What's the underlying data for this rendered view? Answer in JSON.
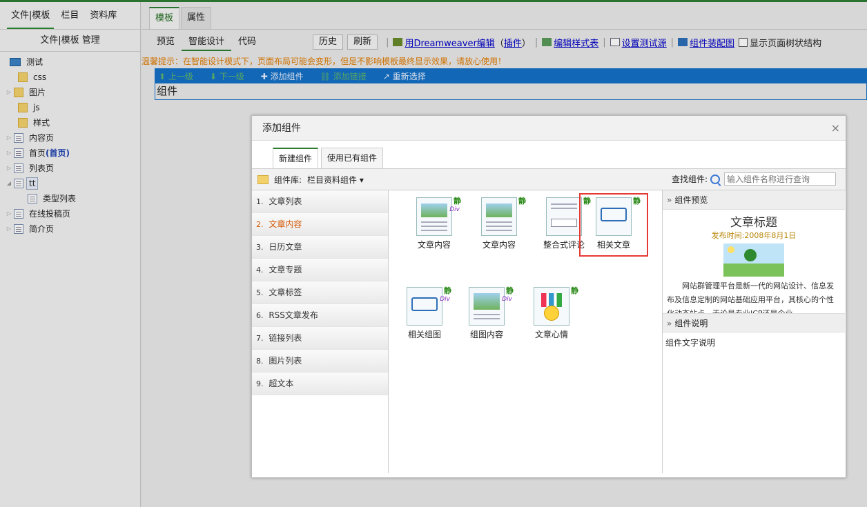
{
  "left": {
    "tabs": [
      "文件|模板",
      "栏目",
      "资料库"
    ],
    "title": "文件|模板 管理",
    "tree": [
      {
        "label": "测试",
        "icon": "monitor-icon"
      },
      {
        "label": "css",
        "icon": "folder-icon"
      },
      {
        "label": "图片",
        "icon": "folder-icon"
      },
      {
        "label": "js",
        "icon": "folder-icon"
      },
      {
        "label": "样式",
        "icon": "style-folder-icon"
      },
      {
        "label": "内容页",
        "icon": "page-icon"
      },
      {
        "label": "首页",
        "extra": "(首页)",
        "icon": "home-page-icon"
      },
      {
        "label": "列表页",
        "icon": "page-icon"
      },
      {
        "label": "tt",
        "icon": "page-icon"
      },
      {
        "label": "类型列表",
        "icon": "page-icon"
      },
      {
        "label": "在线投稿页",
        "icon": "edit-page-icon"
      },
      {
        "label": "简介页",
        "icon": "edit-page-icon"
      }
    ]
  },
  "main": {
    "tabs": [
      "模板",
      "属性"
    ],
    "view_tabs": [
      "预览",
      "智能设计",
      "代码"
    ],
    "buttons": [
      "历史",
      "刷新"
    ],
    "links": {
      "dreamweaver": "用Dreamweaver编辑",
      "paren_open": "（",
      "plugin": "插件",
      "paren_close": "）",
      "edit_style": "编辑样式表",
      "test_source": "设置测试源",
      "assembly": "组件装配图",
      "show_tree": "显示页面树状结构"
    },
    "warning": "温馨提示：在智能设计模式下，页面布局可能会变形，但是不影响模板最终显示效果，请放心使用！",
    "bluebar": [
      "上一级",
      "下一级",
      "添加组件",
      "添加链接",
      "重新选择"
    ],
    "component_label": "组件"
  },
  "dialog": {
    "title": "添加组件",
    "close": "×",
    "tabs": [
      "新建组件",
      "使用已有组件"
    ],
    "library_label": "组件库:",
    "library_value": "栏目资料组件",
    "search_label": "查找组件:",
    "search_placeholder": "输入组件名称进行查询",
    "categories": [
      {
        "num": "1.",
        "label": "文章列表"
      },
      {
        "num": "2.",
        "label": "文章内容"
      },
      {
        "num": "3.",
        "label": "日历文章"
      },
      {
        "num": "4.",
        "label": "文章专题"
      },
      {
        "num": "5.",
        "label": "文章标签"
      },
      {
        "num": "6.",
        "label": "RSS文章发布"
      },
      {
        "num": "7.",
        "label": "链接列表"
      },
      {
        "num": "8.",
        "label": "图片列表"
      },
      {
        "num": "9.",
        "label": "超文本"
      }
    ],
    "items": [
      {
        "label": "文章内容",
        "badge": "静",
        "div": "Div"
      },
      {
        "label": "文章内容",
        "badge": "静",
        "div": ""
      },
      {
        "label": "整合式评论",
        "badge": "静",
        "div": ""
      },
      {
        "label": "相关文章",
        "badge": "静",
        "div": ""
      },
      {
        "label": "相关组图",
        "badge": "静",
        "div": "Div"
      },
      {
        "label": "组图内容",
        "badge": "静",
        "div": "Div"
      },
      {
        "label": "文章心情",
        "badge": "静",
        "div": ""
      }
    ],
    "preview_header": "组件预览",
    "preview_title": "文章标题",
    "preview_date": "发布时间:2008年8月1日",
    "preview_text": "网站群管理平台是新一代的网站设计、信息发布及信息定制的网站基础应用平台，其核心的个性化动态站点。无论是专业ICP还是企业",
    "desc_header": "组件说明",
    "desc_text": "组件文字说明"
  }
}
